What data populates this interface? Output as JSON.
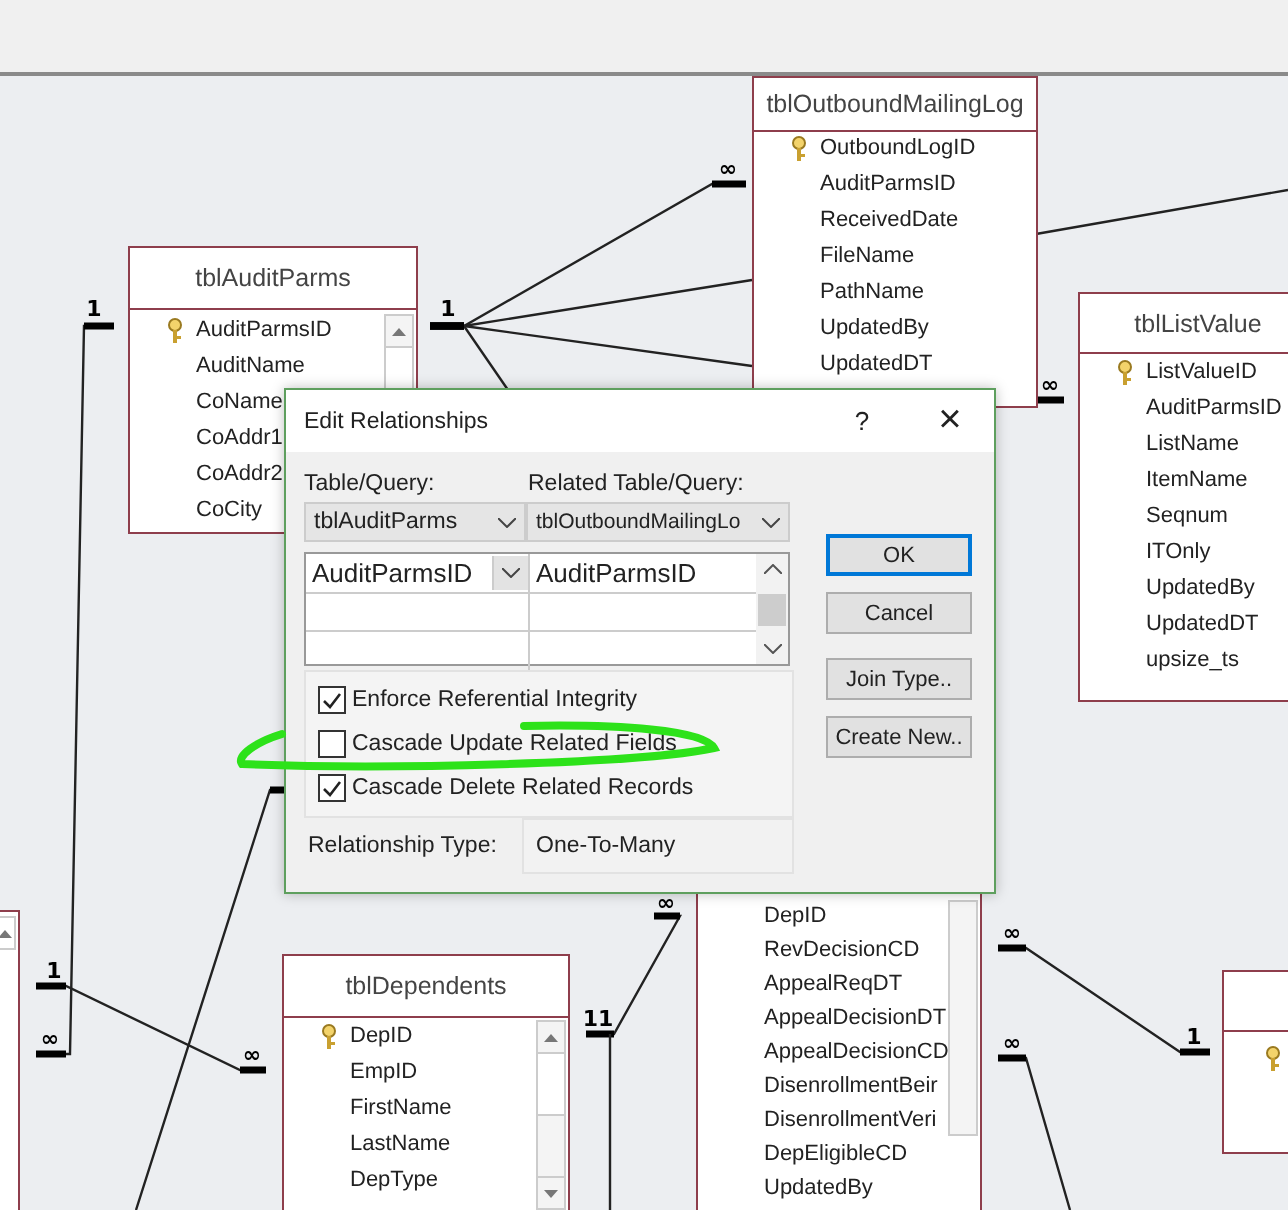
{
  "tables": [
    {
      "name": "tblAuditParms",
      "scrollbar": true,
      "fields": [
        {
          "name": "AuditParmsID",
          "primary_key": true
        },
        {
          "name": "AuditName",
          "primary_key": false
        },
        {
          "name": "CoName",
          "primary_key": false
        },
        {
          "name": "CoAddr1",
          "primary_key": false
        },
        {
          "name": "CoAddr2",
          "primary_key": false
        },
        {
          "name": "CoCity",
          "primary_key": false
        }
      ]
    },
    {
      "name": "tblOutboundMailingLog",
      "scrollbar": false,
      "fields": [
        {
          "name": "OutboundLogID",
          "primary_key": true
        },
        {
          "name": "AuditParmsID",
          "primary_key": false
        },
        {
          "name": "ReceivedDate",
          "primary_key": false
        },
        {
          "name": "FileName",
          "primary_key": false
        },
        {
          "name": "PathName",
          "primary_key": false
        },
        {
          "name": "UpdatedBy",
          "primary_key": false
        },
        {
          "name": "UpdatedDT",
          "primary_key": false
        }
      ]
    },
    {
      "name": "tblListValue",
      "scrollbar": false,
      "fields": [
        {
          "name": "ListValueID",
          "primary_key": true
        },
        {
          "name": "AuditParmsID",
          "primary_key": false
        },
        {
          "name": "ListName",
          "primary_key": false
        },
        {
          "name": "ItemName",
          "primary_key": false
        },
        {
          "name": "Seqnum",
          "primary_key": false
        },
        {
          "name": "ITOnly",
          "primary_key": false
        },
        {
          "name": "UpdatedBy",
          "primary_key": false
        },
        {
          "name": "UpdatedDT",
          "primary_key": false
        },
        {
          "name": "upsize_ts",
          "primary_key": false
        }
      ]
    },
    {
      "name": "tblDependents",
      "scrollbar": true,
      "fields": [
        {
          "name": "DepID",
          "primary_key": true
        },
        {
          "name": "EmpID",
          "primary_key": false
        },
        {
          "name": "FirstName",
          "primary_key": false
        },
        {
          "name": "LastName",
          "primary_key": false
        },
        {
          "name": "DepType",
          "primary_key": false
        }
      ]
    },
    {
      "scrollbar": true,
      "fields": [
        {
          "name": "DepID",
          "primary_key": false
        },
        {
          "name": "RevDecisionCD",
          "primary_key": false
        },
        {
          "name": "AppealReqDT",
          "primary_key": false
        },
        {
          "name": "AppealDecisionDT",
          "primary_key": false
        },
        {
          "name": "AppealDecisionCD",
          "primary_key": false
        },
        {
          "name": "DisenrollmentBeir",
          "primary_key": false
        },
        {
          "name": "DisenrollmentVeri",
          "primary_key": false
        },
        {
          "name": "DepEligibleCD",
          "primary_key": false
        },
        {
          "name": "UpdatedBy",
          "primary_key": false
        }
      ]
    }
  ],
  "cardinality_labels": [
    "1",
    "∞",
    "1",
    "∞",
    "1",
    "∞",
    "∞",
    "11",
    "∞",
    "1",
    "∞",
    "∞"
  ],
  "dialog": {
    "title": "Edit Relationships",
    "help": "?",
    "close": "×",
    "table_label": "Table/Query:",
    "table_value": "tblAuditParms",
    "related_label": "Related Table/Query:",
    "related_value": "tblOutboundMailingLo",
    "field_rows": [
      {
        "left": "AuditParmsID",
        "right": "AuditParmsID"
      }
    ],
    "options": [
      {
        "label": "Enforce Referential Integrity",
        "checked": true
      },
      {
        "label": "Cascade Update Related Fields",
        "checked": false
      },
      {
        "label": "Cascade Delete Related Records",
        "checked": true
      }
    ],
    "relationship_type_label": "Relationship Type:",
    "relationship_type": "One-To-Many",
    "buttons": [
      {
        "label": "OK",
        "default": true
      },
      {
        "label": "Cancel",
        "default": false
      },
      {
        "label": "Join Type..",
        "default": false
      },
      {
        "label": "Create New..",
        "default": false
      }
    ]
  }
}
